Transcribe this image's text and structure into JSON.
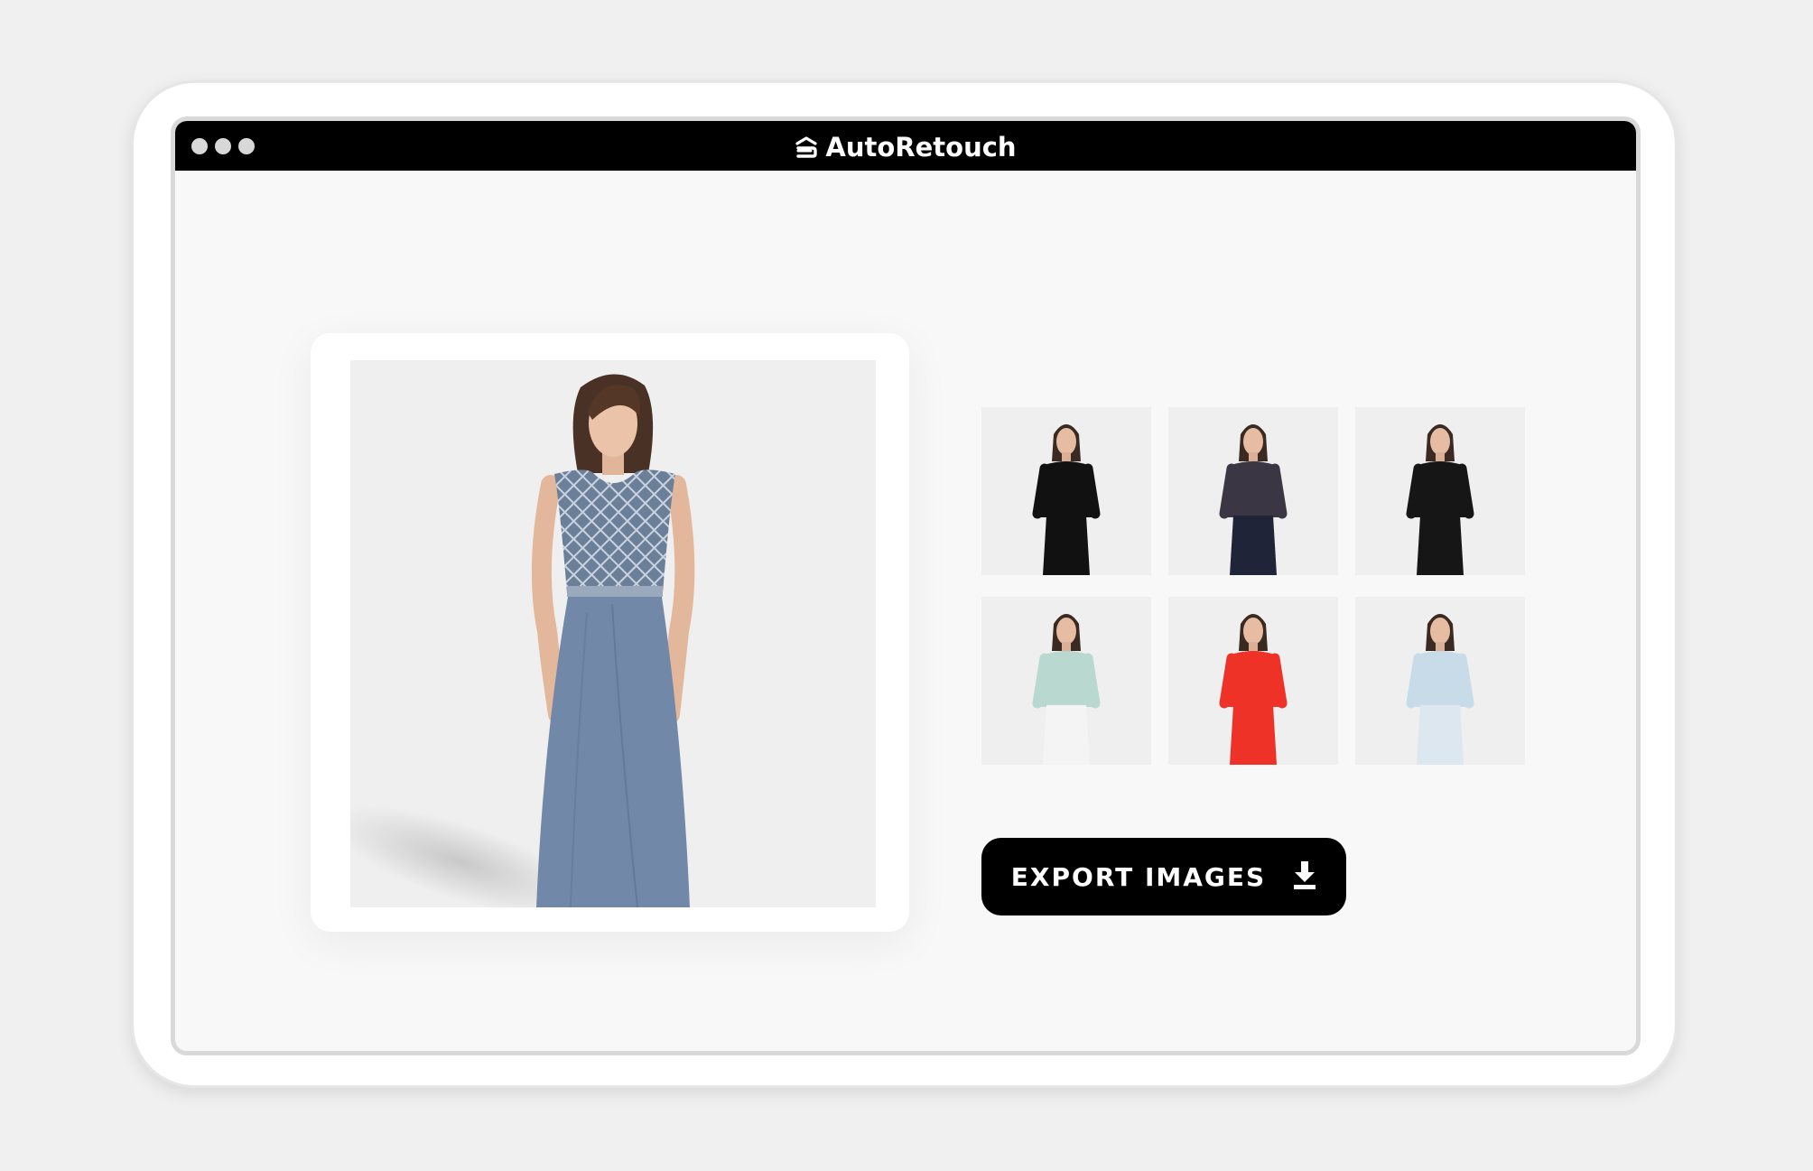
{
  "app": {
    "name": "AutoRetouch",
    "logo_icon": "autoretouch-logo-icon",
    "window_controls": [
      "dot",
      "dot",
      "dot"
    ]
  },
  "main_image": {
    "subject": "model-in-blue-beaded-gown",
    "background": "#efefef",
    "dress_color": "#7188a8"
  },
  "thumbnails": [
    {
      "subject": "black-knit-dress",
      "outfit_color": "#111111",
      "bottom_color": "#111111"
    },
    {
      "subject": "floral-top-navy-skirt-handbag",
      "outfit_color": "#3a3644",
      "bottom_color": "#1f2438"
    },
    {
      "subject": "black-double-breasted-blazer",
      "outfit_color": "#161616",
      "bottom_color": "#161616"
    },
    {
      "subject": "mint-blouse-white-jeans",
      "outfit_color": "#b9d8d0",
      "bottom_color": "#f4f4f4"
    },
    {
      "subject": "red-sleeveless-dress",
      "outfit_color": "#ee3228",
      "bottom_color": "#ee3228"
    },
    {
      "subject": "light-blue-hoodie",
      "outfit_color": "#c8dbe8",
      "bottom_color": "#dde7ef"
    }
  ],
  "export": {
    "label": "EXPORT IMAGES",
    "icon": "download-icon"
  }
}
